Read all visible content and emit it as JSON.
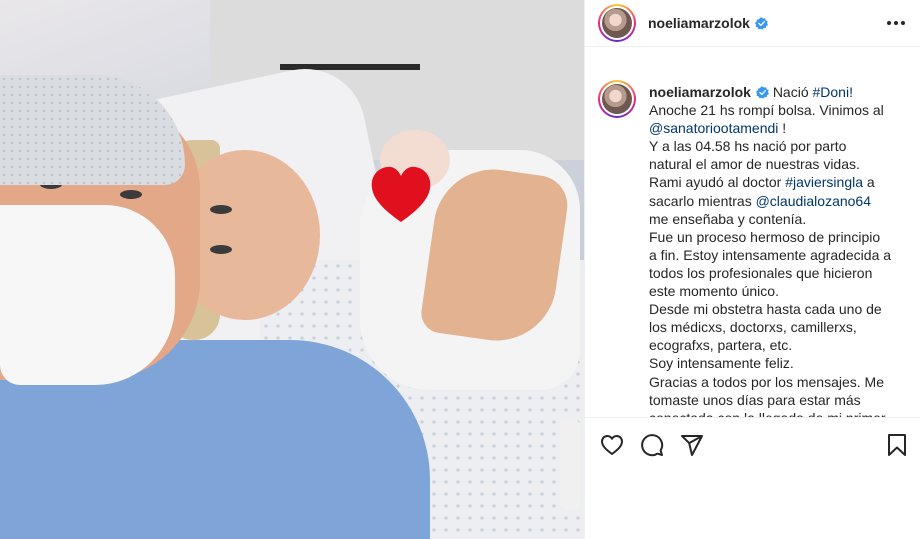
{
  "post": {
    "author": "noeliamarzolok",
    "verified": true,
    "image_alt": "Foto de Noelia Marzol y su pareja en el hospital con el bebé recién nacido"
  },
  "caption": {
    "author": "noeliamarzolok",
    "lines": [
      {
        "text": "Nació ",
        "tag": "#Doni!"
      },
      {
        "text": "Anoche 21 hs rompí bolsa. Vinimos al"
      },
      {
        "tag": "@sanatoriootamendi",
        "text_after": " !"
      },
      {
        "text": "Y a las 04.58 hs nació por parto"
      },
      {
        "text": "natural el amor de nuestras vidas."
      },
      {
        "text": "Rami ayudó al doctor ",
        "tag": "#javiersingla",
        "text_after": " a"
      },
      {
        "text": "sacarlo mientras ",
        "tag": "@claudialozano64"
      },
      {
        "text": "me enseñaba y contenía."
      },
      {
        "text": "Fue un proceso hermoso de principio"
      },
      {
        "text": "a fin. Estoy intensamente agradecida a"
      },
      {
        "text": "todos los profesionales que hicieron"
      },
      {
        "text": "este momento único."
      },
      {
        "text": "Desde mi obstetra hasta cada uno de"
      },
      {
        "text": "los médicxs, doctorxs, camillerxs,"
      },
      {
        "text": "ecografxs, partera, etc."
      },
      {
        "text": "Soy intensamente feliz."
      },
      {
        "text": "Gracias a todos por los mensajes. Me"
      },
      {
        "text": "tomaste unos días para estar más"
      },
      {
        "text": "conectada con la llegada de mi primer"
      }
    ]
  },
  "icons": {
    "verified": "verified-badge-icon",
    "more": "more-options-icon",
    "like": "heart-icon",
    "comment": "comment-icon",
    "share": "paper-plane-icon",
    "save": "bookmark-icon"
  },
  "colors": {
    "verified": "#3897f0",
    "link": "#00376b",
    "heart_sticker": "#e0101e"
  }
}
